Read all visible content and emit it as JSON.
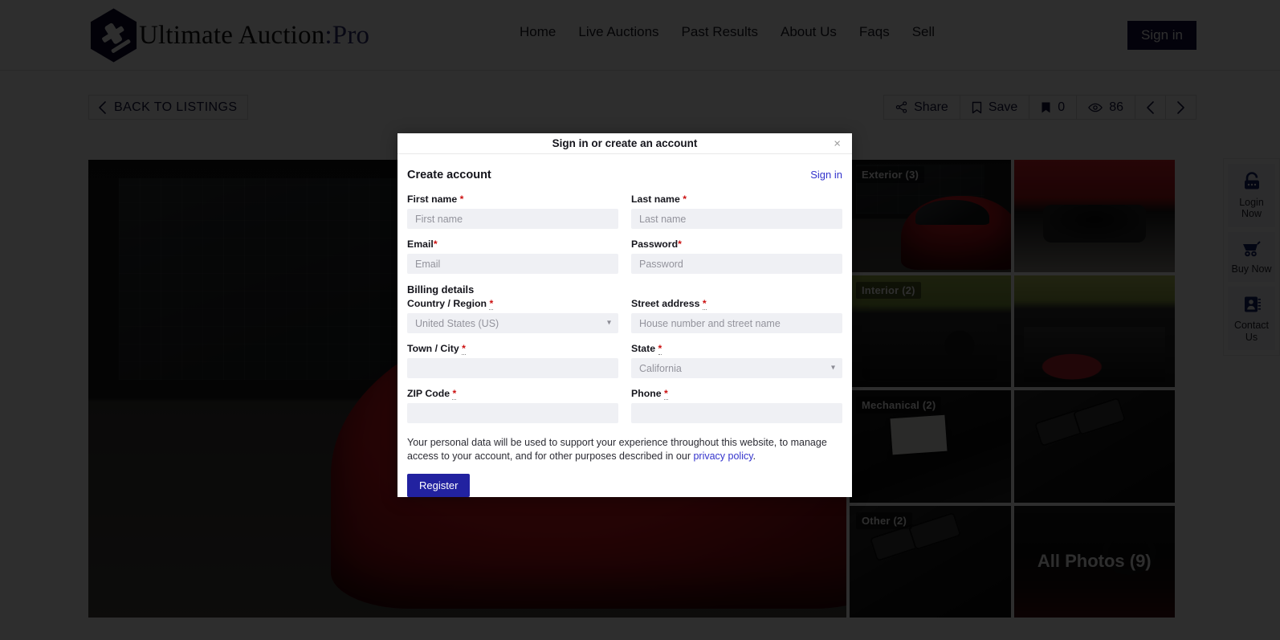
{
  "header": {
    "brand_name": "Ultimate Auction",
    "brand_suffix": ":Pro",
    "nav": [
      {
        "label": "Home"
      },
      {
        "label": "Live Auctions"
      },
      {
        "label": "Past Results"
      },
      {
        "label": "About Us"
      },
      {
        "label": "Faqs"
      },
      {
        "label": "Sell"
      }
    ],
    "signin_label": "Sign in"
  },
  "listing_bar": {
    "back_label": "BACK TO LISTINGS",
    "share_label": "Share",
    "save_label": "Save",
    "bookmark_count": "0",
    "view_count": "86"
  },
  "gallery": {
    "thumbs": [
      {
        "label": "Exterior (3)"
      },
      {
        "label": ""
      },
      {
        "label": "Interior (2)"
      },
      {
        "label": ""
      },
      {
        "label": "Mechanical (2)"
      },
      {
        "label": ""
      },
      {
        "label": "Other (2)"
      },
      {
        "label": ""
      }
    ],
    "all_photos_label": "All Photos (9)"
  },
  "side_rail": {
    "items": [
      {
        "label": "Login Now",
        "icon": "lock-icon"
      },
      {
        "label": "Buy Now",
        "icon": "cart-icon"
      },
      {
        "label": "Contact Us",
        "icon": "contact-card-icon"
      }
    ]
  },
  "modal": {
    "title": "Sign in or create an account",
    "close_label": "×",
    "create_title": "Create account",
    "signin_link": "Sign in",
    "billing_title": "Billing details",
    "fields": {
      "first_name": {
        "label": "First name",
        "req": "*",
        "placeholder": "First name",
        "value": ""
      },
      "last_name": {
        "label": "Last name",
        "req": "*",
        "placeholder": "Last name",
        "value": ""
      },
      "email": {
        "label": "Email",
        "req": "*",
        "placeholder": "Email",
        "value": ""
      },
      "password": {
        "label": "Password",
        "req": "*",
        "placeholder": "Password",
        "value": ""
      },
      "country": {
        "label": "Country / Region ",
        "req": "*",
        "value": "United States (US)"
      },
      "street": {
        "label": "Street address ",
        "req": "*",
        "placeholder": "House number and street name",
        "value": ""
      },
      "city": {
        "label": "Town / City ",
        "req": "*",
        "placeholder": "",
        "value": ""
      },
      "state": {
        "label": "State ",
        "req": "*",
        "value": "California"
      },
      "zip": {
        "label": "ZIP Code ",
        "req": "*",
        "placeholder": "",
        "value": ""
      },
      "phone": {
        "label": "Phone ",
        "req": "*",
        "placeholder": "",
        "value": ""
      }
    },
    "consent_text": "Your personal data will be used to support your experience throughout this website, to manage access to your account, and for other purposes described in our ",
    "consent_link": "privacy policy",
    "consent_tail": ".",
    "register_label": "Register"
  },
  "colors": {
    "brand_dark": "#140d3c",
    "accent_blue": "#3333cc",
    "register_blue": "#2222a0",
    "required_red": "#cc1111",
    "rail_icon": "#15216b"
  }
}
